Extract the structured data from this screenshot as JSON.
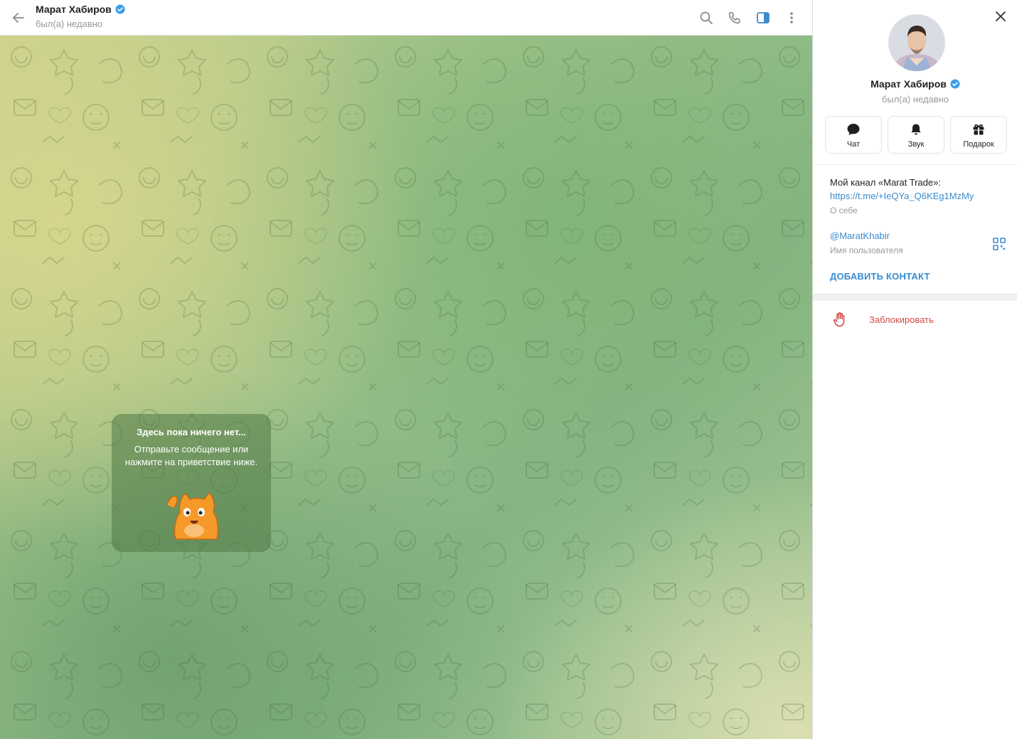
{
  "header": {
    "name": "Марат Хабиров",
    "status": "был(а) недавно"
  },
  "empty_state": {
    "title": "Здесь пока ничего нет...",
    "text": "Отправьте сообщение или нажмите на приветствие ниже."
  },
  "profile": {
    "name": "Марат Хабиров",
    "status": "был(а) недавно",
    "actions": [
      {
        "label": "Чат",
        "icon": "chat-bubble-icon"
      },
      {
        "label": "Звук",
        "icon": "bell-icon"
      },
      {
        "label": "Подарок",
        "icon": "gift-icon"
      }
    ],
    "bio_line": "Мой канал «Marat Trade»:",
    "bio_link": "https://t.me/+IeQYa_Q6KEg1MzMy",
    "bio_caption": "О себе",
    "username": "@MaratKhabir",
    "username_caption": "Имя пользователя",
    "add_contact": "ДОБАВИТЬ КОНТАКТ",
    "block": "Заблокировать"
  },
  "colors": {
    "accent": "#3a8bd0",
    "verified": "#3a9ee8",
    "danger": "#d14b4b",
    "sticker": "#f59a2a"
  }
}
